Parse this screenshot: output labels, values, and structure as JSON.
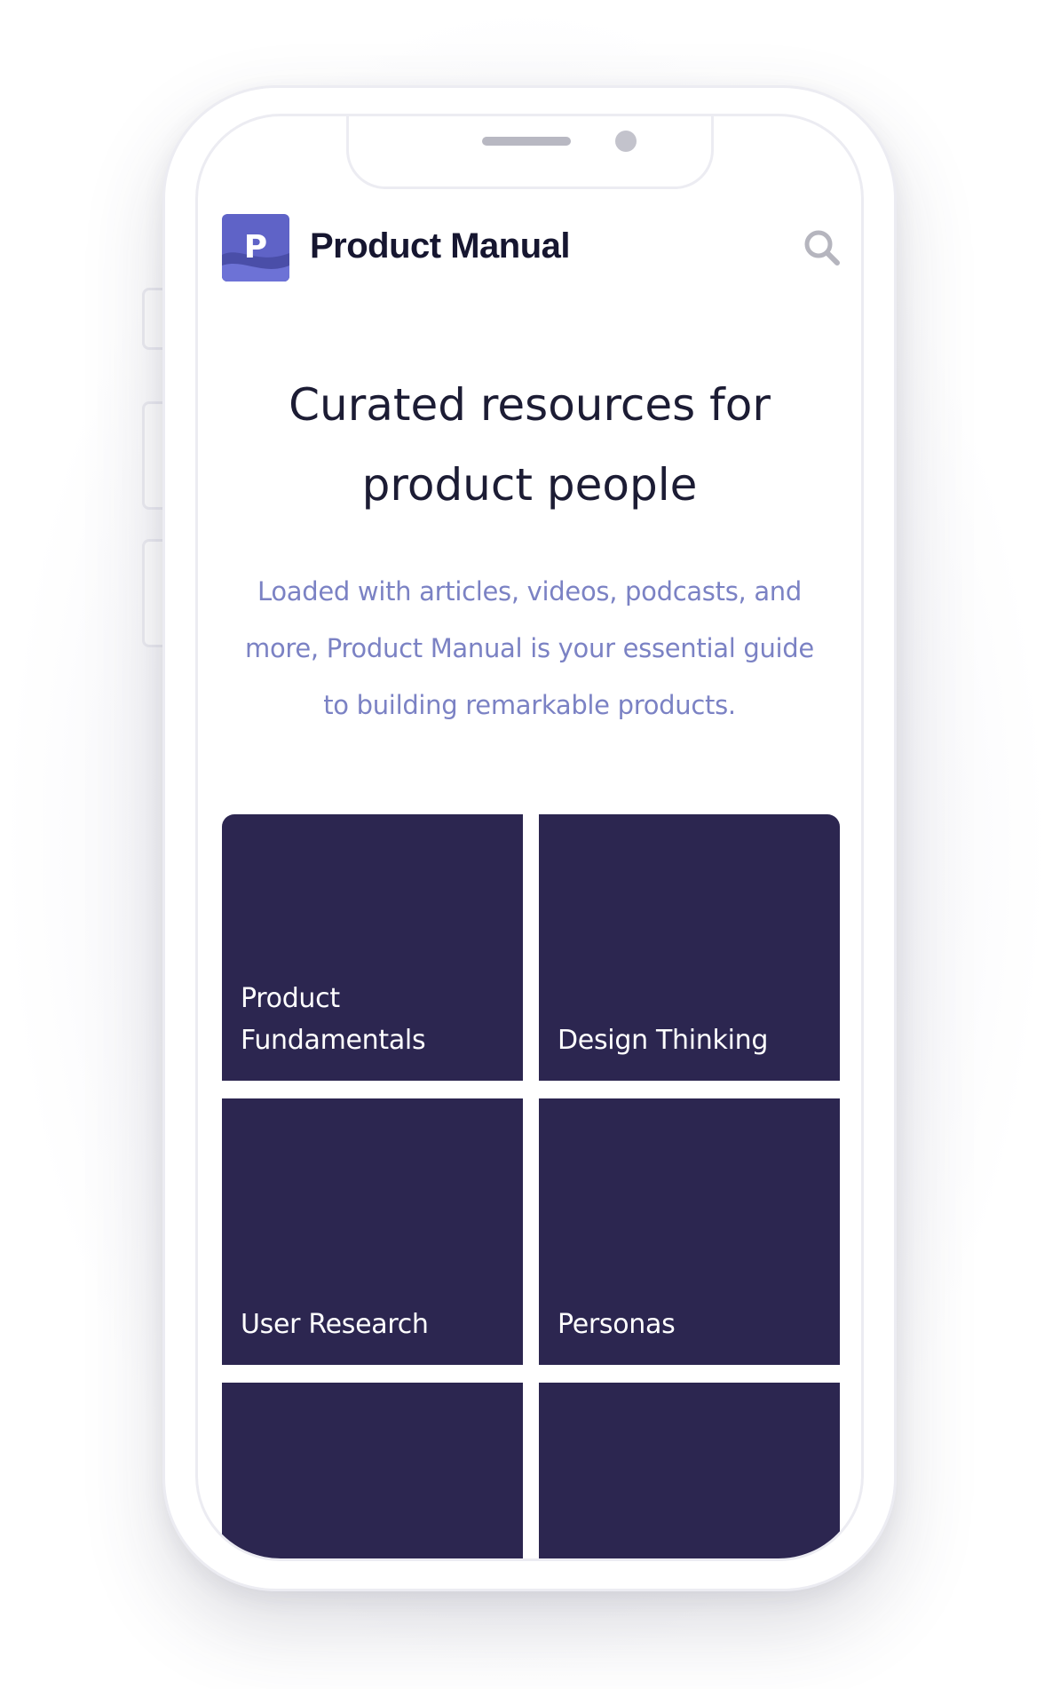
{
  "app": {
    "logo_letter": "P",
    "name": "Product Manual"
  },
  "hero": {
    "title_lines": [
      "Curated resources for",
      "product people"
    ],
    "subtitle_lines": [
      "Loaded with articles, videos, podcasts, and",
      "more, Product Manual is your essential guide",
      "to building remarkable products."
    ]
  },
  "categories": [
    {
      "label_lines": [
        "Product",
        "Fundamentals"
      ]
    },
    {
      "label_lines": [
        "Design Thinking"
      ]
    },
    {
      "label_lines": [
        "User Research"
      ]
    },
    {
      "label_lines": [
        "Personas"
      ]
    },
    {
      "label_lines": []
    },
    {
      "label_lines": []
    }
  ],
  "icons": {
    "search": "search-icon",
    "logo": "product-manual-logo"
  },
  "colors": {
    "tile_background": "#2c2650",
    "logo_accent": "#5f63c7",
    "subtitle": "#7b82c4",
    "title": "#1c1c34"
  }
}
